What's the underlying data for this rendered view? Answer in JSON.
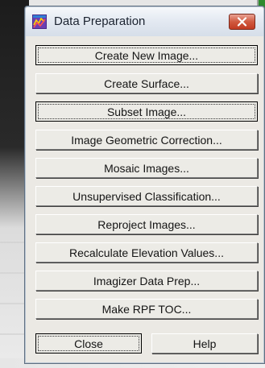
{
  "dialog": {
    "title": "Data Preparation",
    "icon": "data-preparation-app-icon",
    "close_icon": "close-icon",
    "accent_color": "#c23b22"
  },
  "buttons": [
    {
      "label": "Create New Image..."
    },
    {
      "label": "Create Surface..."
    },
    {
      "label": "Subset Image..."
    },
    {
      "label": "Image Geometric Correction..."
    },
    {
      "label": "Mosaic Images..."
    },
    {
      "label": "Unsupervised Classification..."
    },
    {
      "label": "Reproject Images..."
    },
    {
      "label": "Recalculate Elevation Values..."
    },
    {
      "label": "Imagizer Data Prep..."
    },
    {
      "label": "Make RPF TOC..."
    }
  ],
  "footer": {
    "close_label": "Close",
    "help_label": "Help"
  }
}
